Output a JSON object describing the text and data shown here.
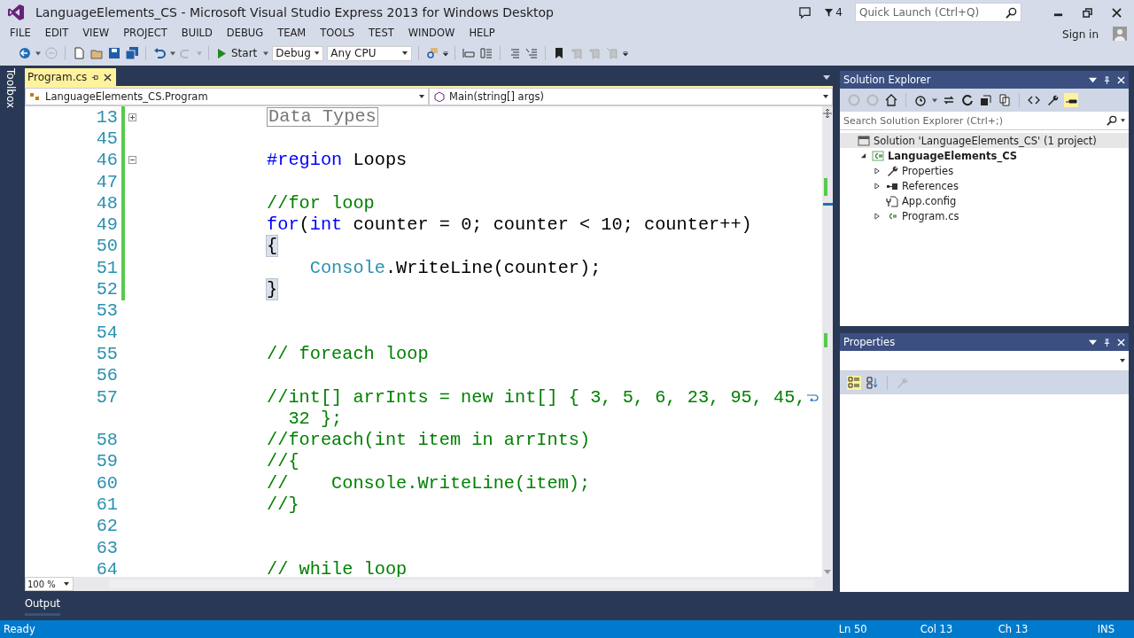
{
  "window": {
    "title": "LanguageElements_CS - Microsoft Visual Studio Express 2013 for Windows Desktop"
  },
  "title_bar": {
    "notification_count": "4",
    "quick_launch": {
      "placeholder": "Quick Launch (Ctrl+Q)"
    },
    "sign_in": "Sign in"
  },
  "menu": [
    "FILE",
    "EDIT",
    "VIEW",
    "PROJECT",
    "BUILD",
    "DEBUG",
    "TEAM",
    "TOOLS",
    "TEST",
    "WINDOW",
    "HELP"
  ],
  "toolbar": {
    "start": "Start",
    "configuration": "Debug",
    "platform": "Any CPU"
  },
  "side_tab": "Toolbox",
  "editor": {
    "tabs": [
      {
        "label": "Program.cs",
        "selected": true
      }
    ],
    "type_dropdown": "LanguageElements_CS.Program",
    "member_dropdown": "Main(string[] args)",
    "lines": [
      {
        "number": "13",
        "changed": true,
        "region_collapsed": true,
        "tokens": [
          {
            "kind": "collapsed",
            "text": "            Data Types"
          }
        ]
      },
      {
        "number": "45",
        "changed": true
      },
      {
        "number": "46",
        "changed": true,
        "region_collapsed": false,
        "tokens": [
          {
            "kind": "keyword",
            "text": "            #region"
          },
          {
            "kind": "plain",
            "text": " Loops"
          }
        ]
      },
      {
        "number": "47",
        "changed": true
      },
      {
        "number": "48",
        "changed": true,
        "tokens": [
          {
            "kind": "comment",
            "text": "            //for loop"
          }
        ]
      },
      {
        "number": "49",
        "changed": true,
        "tokens": [
          {
            "kind": "keyword",
            "text": "            for"
          },
          {
            "kind": "plain",
            "text": "("
          },
          {
            "kind": "keyword",
            "text": "int"
          },
          {
            "kind": "plain",
            "text": " counter = 0; counter < 10; counter++)"
          }
        ]
      },
      {
        "number": "50",
        "changed": true,
        "tokens": [
          {
            "kind": "brace",
            "matched": true,
            "text": "            {"
          }
        ]
      },
      {
        "number": "51",
        "changed": true,
        "tokens": [
          {
            "kind": "type",
            "text": "                Console"
          },
          {
            "kind": "plain",
            "text": ".WriteLine(counter);"
          }
        ]
      },
      {
        "number": "52",
        "changed": true,
        "tokens": [
          {
            "kind": "brace",
            "matched": true,
            "text": "            }"
          }
        ]
      },
      {
        "number": "53",
        "changed": false
      },
      {
        "number": "54",
        "changed": false
      },
      {
        "number": "55",
        "changed": false,
        "tokens": [
          {
            "kind": "comment",
            "text": "            // foreach loop"
          }
        ]
      },
      {
        "number": "56",
        "changed": false
      },
      {
        "number": "57",
        "changed": false,
        "tokens": [
          {
            "kind": "comment",
            "text": "            //int[] arrInts = new int[] { 3, 5, 6, 23, 95, 45,"
          }
        ],
        "continuation": "32 };"
      },
      {
        "number": "58",
        "changed": false,
        "tokens": [
          {
            "kind": "comment",
            "text": "            //foreach(int item in arrInts)"
          }
        ]
      },
      {
        "number": "59",
        "changed": false,
        "tokens": [
          {
            "kind": "comment",
            "text": "            //{"
          }
        ]
      },
      {
        "number": "60",
        "changed": false,
        "tokens": [
          {
            "kind": "comment",
            "text": "            //    Console.WriteLine(item);"
          }
        ]
      },
      {
        "number": "61",
        "changed": false,
        "tokens": [
          {
            "kind": "comment",
            "text": "            //}"
          }
        ]
      },
      {
        "number": "62",
        "changed": false
      },
      {
        "number": "63",
        "changed": false
      },
      {
        "number": "64",
        "changed": false,
        "tokens": [
          {
            "kind": "comment",
            "text": "            // while loop"
          }
        ]
      }
    ],
    "zoom": "100 %"
  },
  "solution_explorer": {
    "title": "Solution Explorer",
    "search": {
      "placeholder": "Search Solution Explorer (Ctrl+;)"
    },
    "tree": [
      {
        "label": "Solution 'LanguageElements_CS' (1 project)",
        "kind": "solution",
        "selected": true,
        "children": [
          {
            "label": "LanguageElements_CS",
            "kind": "project",
            "selected": false,
            "expanded": true,
            "children": [
              {
                "label": "Properties",
                "kind": "properties",
                "selected": false,
                "expanded": false
              },
              {
                "label": "References",
                "kind": "references",
                "selected": false,
                "expanded": false
              },
              {
                "label": "App.config",
                "kind": "config",
                "selected": false
              },
              {
                "label": "Program.cs",
                "kind": "csharp",
                "selected": false,
                "expanded": false
              }
            ]
          }
        ]
      }
    ]
  },
  "properties": {
    "title": "Properties"
  },
  "bottom_tabs": [
    {
      "label": "Output"
    }
  ],
  "status_bar": {
    "state": "Ready",
    "line": "Ln 50",
    "column": "Col 13",
    "char": "Ch 13",
    "mode": "INS"
  }
}
